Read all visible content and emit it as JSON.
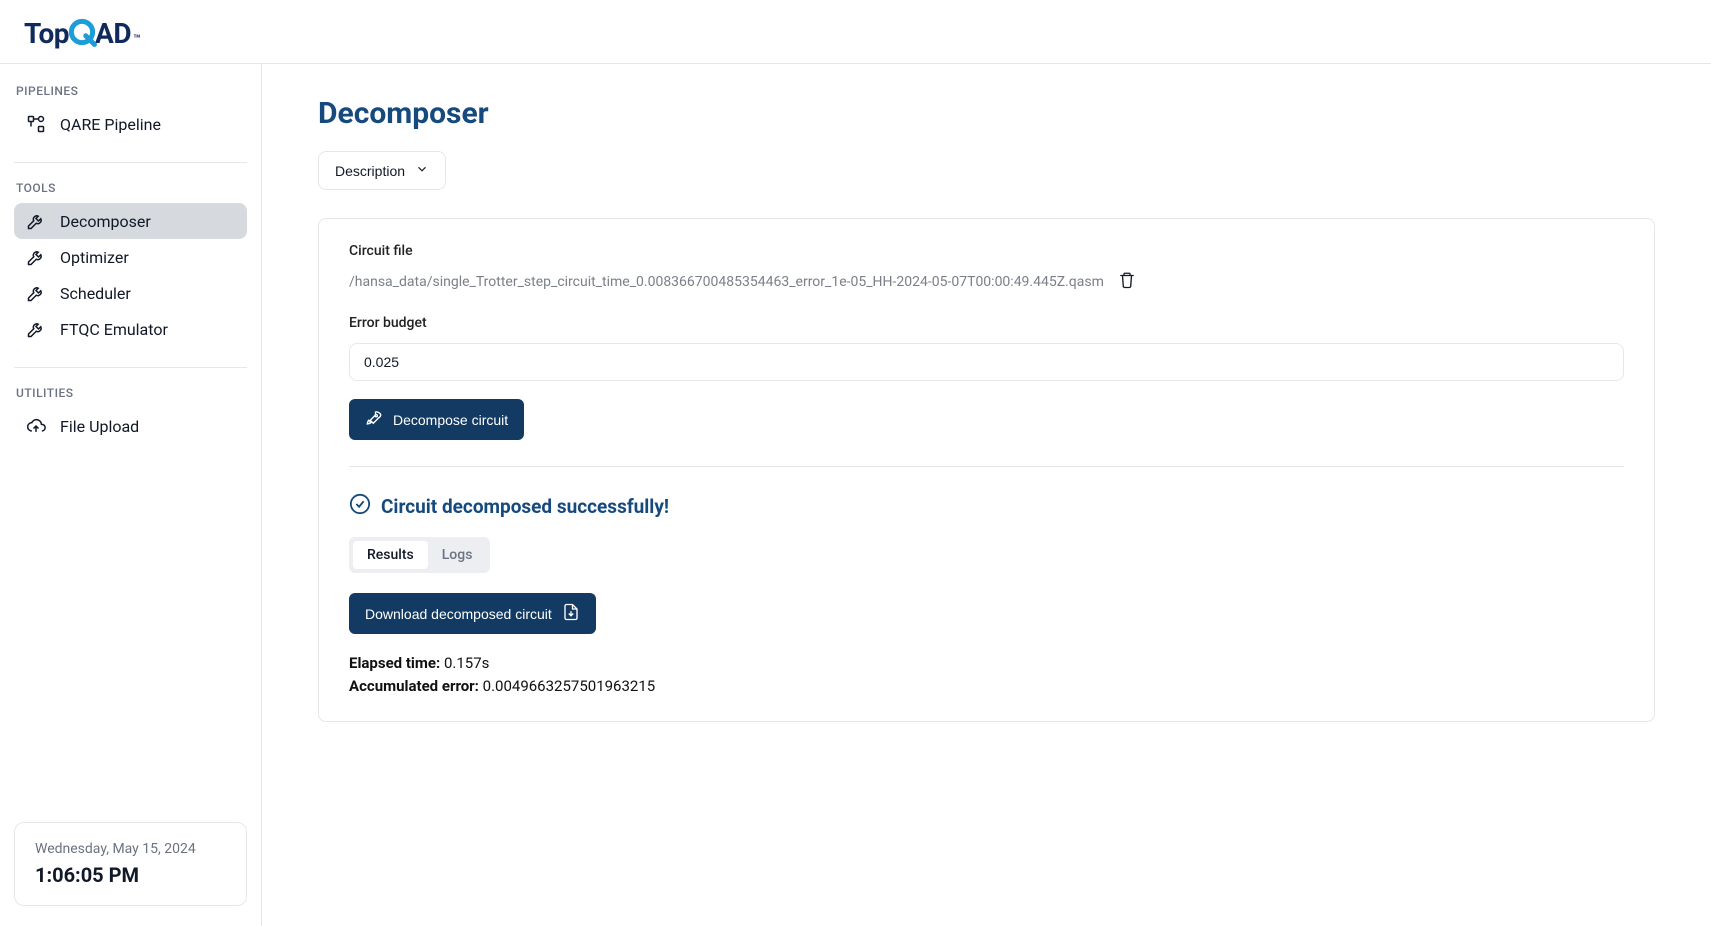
{
  "app": {
    "logo_prefix": "Top",
    "logo_suffix": "AD",
    "logo_tm": "™"
  },
  "sidebar": {
    "sections": {
      "pipelines": {
        "title": "PIPELINES",
        "items": [
          {
            "label": "QARE Pipeline"
          }
        ]
      },
      "tools": {
        "title": "TOOLS",
        "items": [
          {
            "label": "Decomposer"
          },
          {
            "label": "Optimizer"
          },
          {
            "label": "Scheduler"
          },
          {
            "label": "FTQC Emulator"
          }
        ]
      },
      "utilities": {
        "title": "UTILITIES",
        "items": [
          {
            "label": "File Upload"
          }
        ]
      }
    },
    "clock": {
      "date": "Wednesday, May 15, 2024",
      "time": "1:06:05 PM"
    }
  },
  "main": {
    "title": "Decomposer",
    "description_button": "Description",
    "circuit_file_label": "Circuit file",
    "circuit_file_path": "/hansa_data/single_Trotter_step_circuit_time_0.008366700485354463_error_1e-05_HH-2024-05-07T00:00:49.445Z.qasm",
    "error_budget_label": "Error budget",
    "error_budget_value": "0.025",
    "decompose_button": "Decompose circuit",
    "success_message": "Circuit decomposed successfully!",
    "tabs": {
      "results": "Results",
      "logs": "Logs"
    },
    "download_button": "Download decomposed circuit",
    "stats": {
      "elapsed_label": "Elapsed time:",
      "elapsed_value": "0.157s",
      "accum_label": "Accumulated error:",
      "accum_value": "0.0049663257501963215"
    }
  }
}
